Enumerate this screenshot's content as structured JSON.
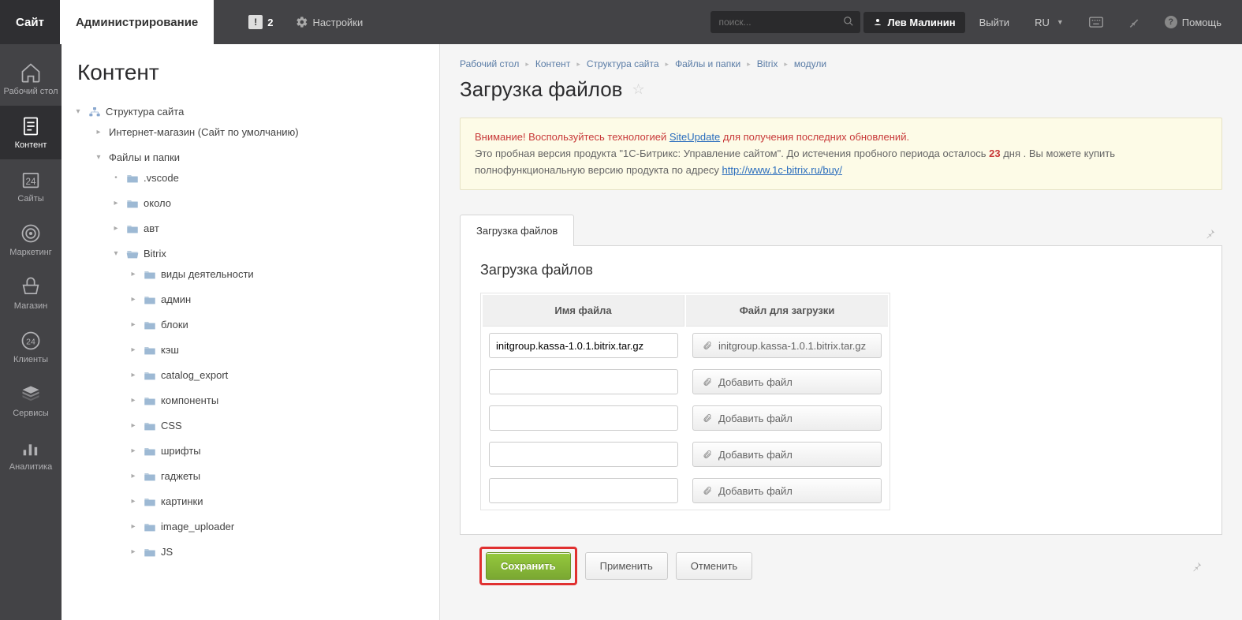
{
  "top": {
    "site": "Сайт",
    "admin": "Администрирование",
    "notifications_count": "2",
    "settings": "Настройки",
    "search_placeholder": "поиск...",
    "user": "Лев Малинин",
    "logout": "Выйти",
    "lang": "RU ",
    "help": "Помощь"
  },
  "iconbar": [
    {
      "label": "Рабочий стол"
    },
    {
      "label": "Контент"
    },
    {
      "label": "Сайты"
    },
    {
      "label": "Маркетинг"
    },
    {
      "label": "Магазин"
    },
    {
      "label": "Клиенты"
    },
    {
      "label": "Сервисы"
    },
    {
      "label": "Аналитика"
    }
  ],
  "tree": {
    "title": "Контент",
    "root": "Структура сайта",
    "shop": "Интернет-магазин (Сайт по умолчанию)",
    "files": "Файлы и папки",
    "items": [
      ".vscode",
      "около",
      "авт",
      "Bitrix"
    ],
    "bitrix_children": [
      "виды деятельности",
      "админ",
      "блоки",
      "кэш",
      "catalog_export",
      "компоненты",
      "CSS",
      "шрифты",
      "гаджеты",
      "картинки",
      "image_uploader",
      "JS"
    ]
  },
  "crumbs": [
    "Рабочий стол",
    "Контент",
    "Структура сайта",
    "Файлы и папки",
    "Bitrix",
    "модули"
  ],
  "page_title": "Загрузка файлов",
  "alert": {
    "l1a": "Внимание! Воспользуйтесь технологией ",
    "l1link": "SiteUpdate",
    "l1b": " для получения последних обновлений.",
    "l2a": "Это пробная версия продукта \"1С-Битрикс: Управление сайтом\". До истечения пробного периода осталось ",
    "days": "23",
    "l2b": " дня . Вы можете купить полнофункциональную версию продукта по адресу ",
    "l2link": "http://www.1c-bitrix.ru/buy/"
  },
  "tab": "Загрузка файлов",
  "panel_title": "Загрузка файлов",
  "cols": {
    "name": "Имя файла",
    "file": "Файл для загрузки"
  },
  "rows": [
    {
      "name": "initgroup.kassa-1.0.1.bitrix.tar.gz",
      "btn": "initgroup.kassa-1.0.1.bitrix.tar.gz"
    },
    {
      "name": "",
      "btn": "Добавить файл"
    },
    {
      "name": "",
      "btn": "Добавить файл"
    },
    {
      "name": "",
      "btn": "Добавить файл"
    },
    {
      "name": "",
      "btn": "Добавить файл"
    }
  ],
  "buttons": {
    "save": "Сохранить",
    "apply": "Применить",
    "cancel": "Отменить"
  }
}
